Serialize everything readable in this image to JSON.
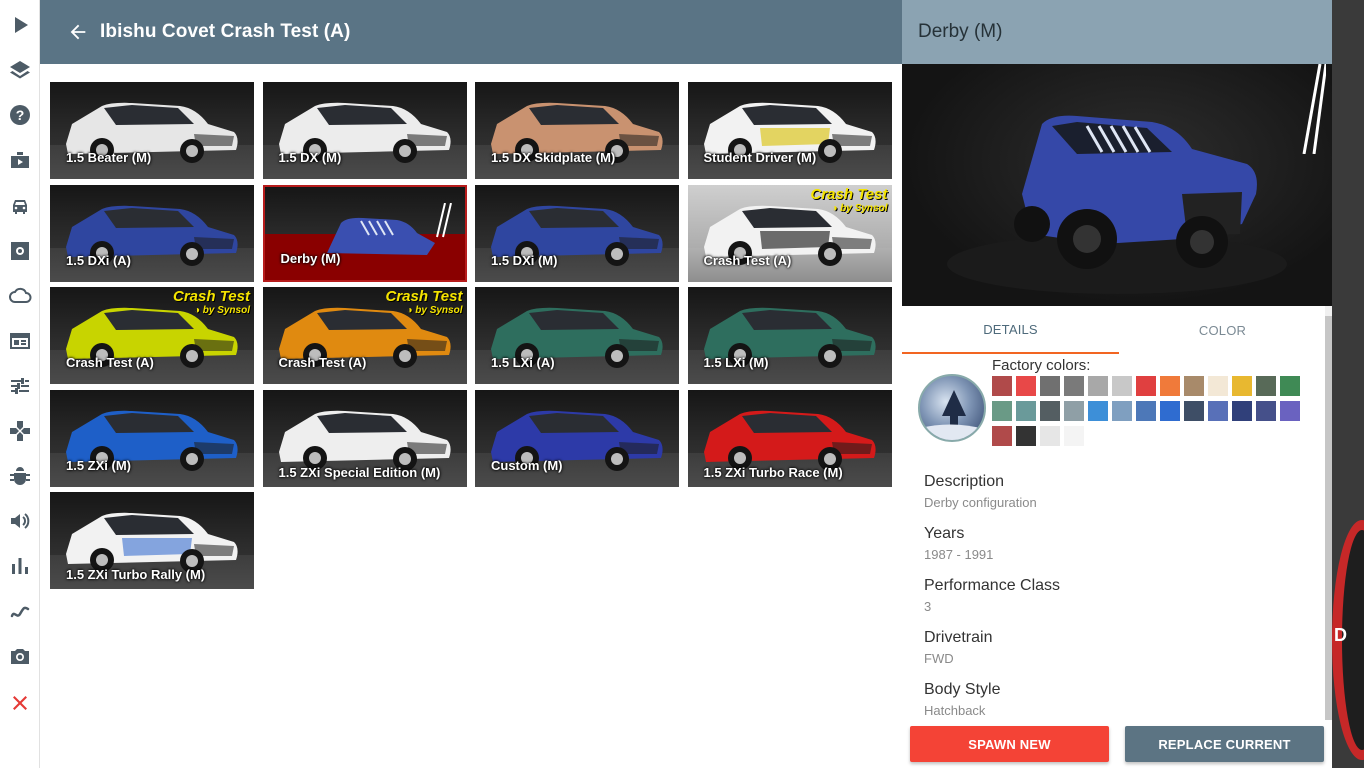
{
  "header": {
    "title": "Ibishu Covet Crash Test (A)"
  },
  "sidebar": {
    "items": [
      "play-icon",
      "layers-icon",
      "help-icon",
      "scenarios-icon",
      "vehicles-icon",
      "vehicle-config-icon",
      "environment-icon",
      "ui-apps-icon",
      "options-icon",
      "controls-icon",
      "debug-icon",
      "audio-icon",
      "performance-icon",
      "track-builder-icon",
      "photo-mode-icon",
      "exit-icon"
    ]
  },
  "tiles": [
    {
      "label": "1.5 Beater (M)",
      "color": "#e6e6e6"
    },
    {
      "label": "1.5 DX (M)",
      "color": "#ececec"
    },
    {
      "label": "1.5 DX Skidplate (M)",
      "color": "#c99270"
    },
    {
      "label": "Student Driver (M)",
      "color": "#f2f2f2",
      "accent": "#d8c000"
    },
    {
      "label": "1.5 DXi (A)",
      "color": "#2f46a0"
    },
    {
      "label": "Derby (M)",
      "color": "#3a4fb0"
    },
    {
      "label": "1.5 DXi (M)",
      "color": "#2f46a0"
    },
    {
      "label": "Crash Test (A)",
      "color": "#f2f2f2",
      "accent": "#111111"
    },
    {
      "label": "Crash Test (A)",
      "color": "#c8d400"
    },
    {
      "label": "Crash Test (A)",
      "color": "#e08a10"
    },
    {
      "label": "1.5 LXi (A)",
      "color": "#2e6e5e"
    },
    {
      "label": "1.5 LXi (M)",
      "color": "#2e6e5e"
    },
    {
      "label": "1.5 ZXi (M)",
      "color": "#1e5fc8"
    },
    {
      "label": "1.5 ZXi Special Edition (M)",
      "color": "#eeeeee"
    },
    {
      "label": "Custom (M)",
      "color": "#2d3aa8"
    },
    {
      "label": "1.5 ZXi Turbo Race (M)",
      "color": "#d41a1a"
    },
    {
      "label": "1.5 ZXi Turbo Rally (M)",
      "color": "#f2f2f2",
      "accent": "#3a6fd0"
    }
  ],
  "badges": {
    "line1": "Crash Test",
    "line2": "by Synsol"
  },
  "preview": {
    "title": "Derby (M)",
    "car_color": "#3548a8"
  },
  "tabs": {
    "details": "DETAILS",
    "color": "COLOR"
  },
  "factory_colors": {
    "title": "Factory colors:",
    "swatches": [
      "#b04a4a",
      "#e84848",
      "#707070",
      "#7a7a7a",
      "#a8a8a8",
      "#c8c8c8",
      "#e04040",
      "#f07a3a",
      "#a88a6a",
      "#f3e8d6",
      "#e8b830",
      "#586a58",
      "#3f8a55",
      "#6a9a86",
      "#6a9a9a",
      "#545e62",
      "#8f9fa6",
      "#3d8fd8",
      "#7f9fc0",
      "#4d78b8",
      "#2f6cd0",
      "#3e4e66",
      "#5870b8",
      "#30407a",
      "#45508a",
      "#6a62c0",
      "#b04a4a",
      "#333333",
      "#e6e6e6",
      "#f4f4f4"
    ]
  },
  "info": [
    {
      "label": "Description",
      "value": "Derby configuration"
    },
    {
      "label": "Years",
      "value": "1987 - 1991"
    },
    {
      "label": "Performance Class",
      "value": "3"
    },
    {
      "label": "Drivetrain",
      "value": "FWD"
    },
    {
      "label": "Body Style",
      "value": "Hatchback"
    }
  ],
  "buttons": {
    "spawn": "SPAWN NEW",
    "replace": "REPLACE CURRENT"
  },
  "accent": "#f26522"
}
